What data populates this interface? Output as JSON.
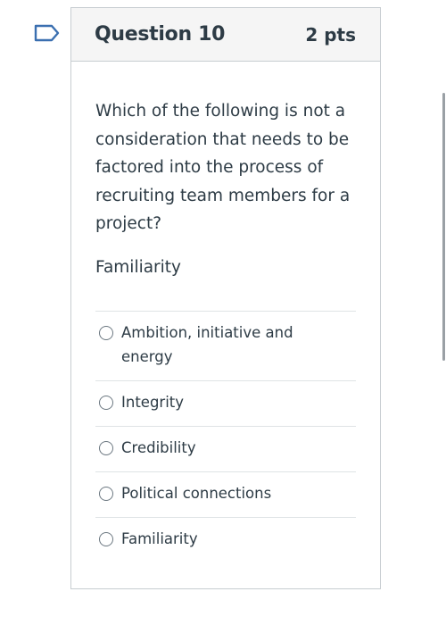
{
  "question": {
    "title": "Question 10",
    "points": "2 pts",
    "text": "Which of the following is not a consideration that needs to be factored into the process of recruiting team members for a project?",
    "selected_display": "Familiarity"
  },
  "answers": [
    {
      "label": "Ambition, initiative and energy",
      "selected": false
    },
    {
      "label": "Integrity",
      "selected": false
    },
    {
      "label": "Credibility",
      "selected": false
    },
    {
      "label": "Political connections",
      "selected": false
    },
    {
      "label": "Familiarity",
      "selected": false
    }
  ],
  "icons": {
    "flag": "flag-icon"
  },
  "colors": {
    "flag_outline": "#3a6fb0",
    "header_bg": "#f5f5f5",
    "text": "#2d3b45",
    "border": "#c7cdd1"
  }
}
